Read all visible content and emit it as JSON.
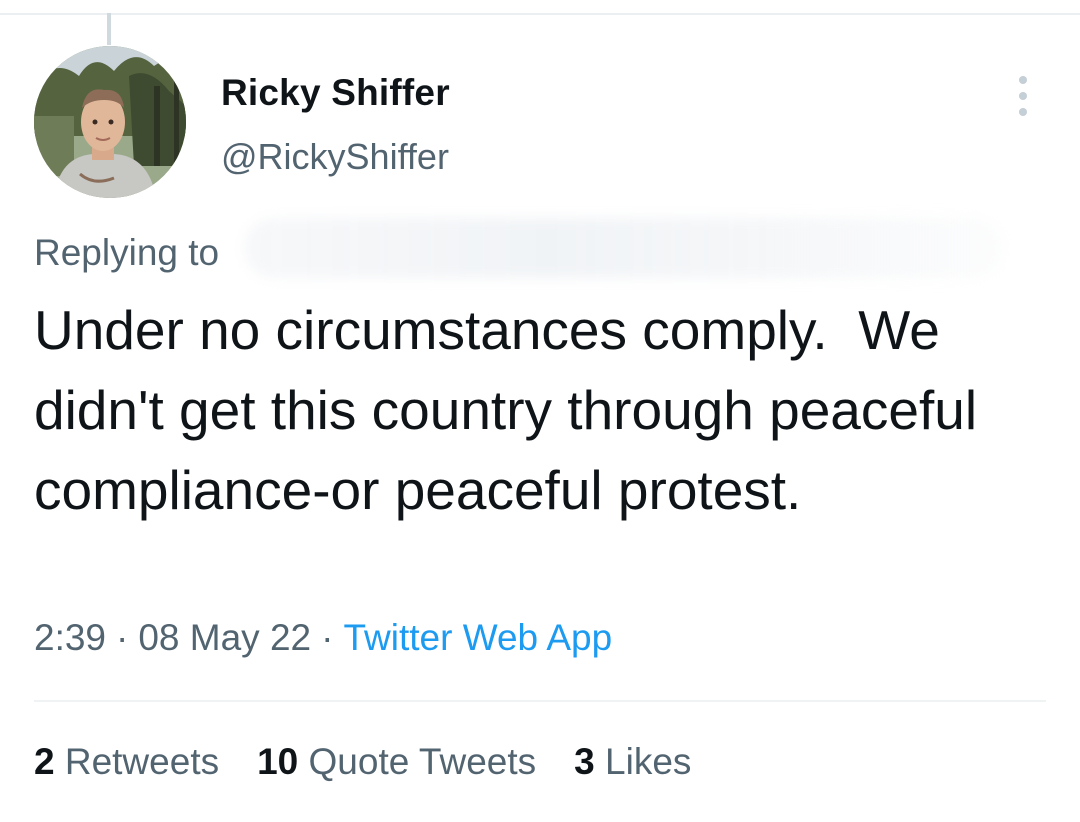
{
  "tweet": {
    "author": {
      "display_name": "Ricky Shiffer",
      "handle": "@RickyShiffer"
    },
    "replying_to_label": "Replying to",
    "text": "Under no circumstances comply.  We didn't get this country through peaceful compliance-or peaceful protest.",
    "time": "2:39",
    "separator": "·",
    "date": "08 May 22",
    "source": "Twitter Web App",
    "stats": [
      {
        "count": "2",
        "label": "Retweets"
      },
      {
        "count": "10",
        "label": "Quote Tweets"
      },
      {
        "count": "3",
        "label": "Likes"
      }
    ]
  },
  "icons": {
    "more": "more-horizontal-icon"
  },
  "colors": {
    "text_primary": "#0f1419",
    "text_secondary": "#536471",
    "link": "#1d9bf0"
  }
}
